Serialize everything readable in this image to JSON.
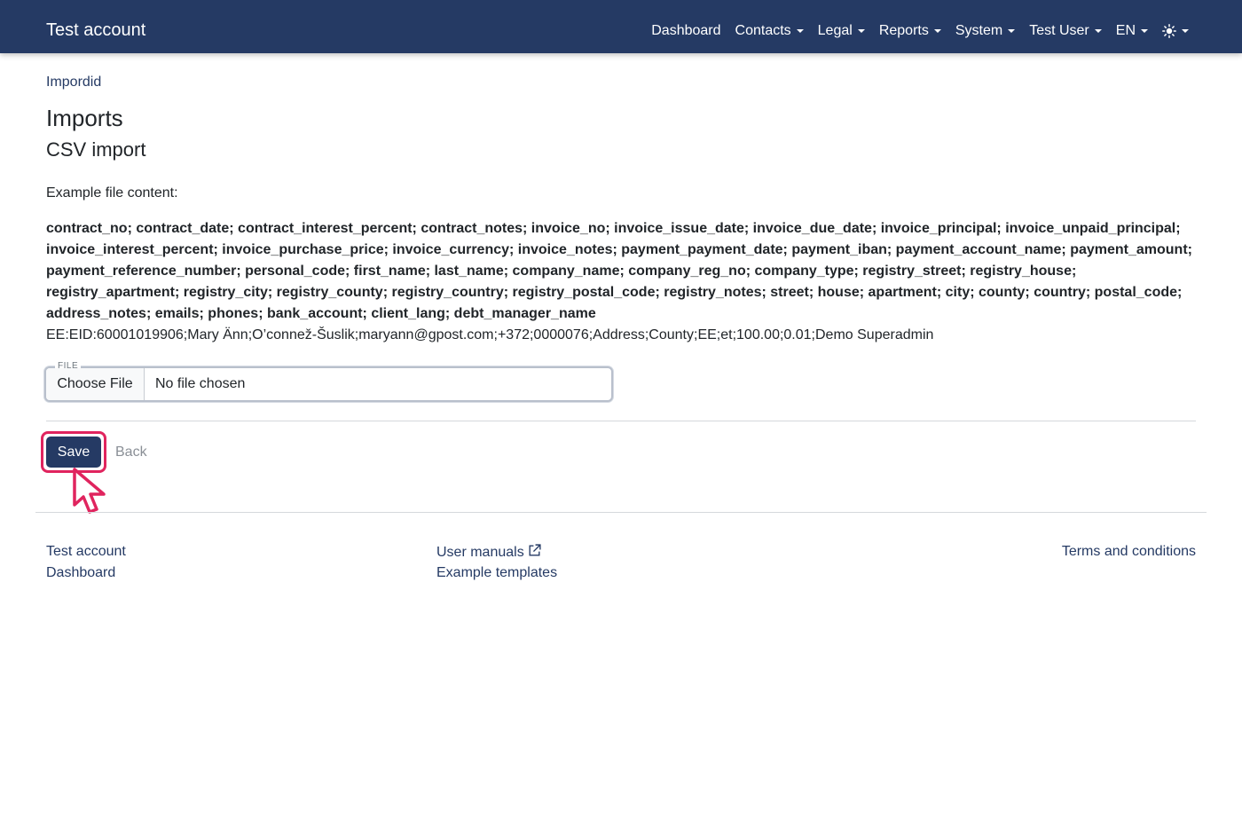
{
  "navbar": {
    "brand": "Test account",
    "items": [
      {
        "label": "Dashboard",
        "dropdown": false
      },
      {
        "label": "Contacts",
        "dropdown": true
      },
      {
        "label": "Legal",
        "dropdown": true
      },
      {
        "label": "Reports",
        "dropdown": true
      },
      {
        "label": "System",
        "dropdown": true
      },
      {
        "label": "Test User",
        "dropdown": true
      },
      {
        "label": "EN",
        "dropdown": true
      }
    ],
    "theme_icon": "sun-icon",
    "bg_color": "#253a64"
  },
  "breadcrumb": "Impordid",
  "page": {
    "title": "Imports",
    "subtitle": "CSV import",
    "example_label": "Example file content:",
    "example_headers": "contract_no; contract_date; contract_interest_percent; contract_notes; invoice_no; invoice_issue_date; invoice_due_date; invoice_principal; invoice_unpaid_principal; invoice_interest_percent; invoice_purchase_price; invoice_currency; invoice_notes; payment_payment_date; payment_iban; payment_account_name; payment_amount; payment_reference_number; personal_code; first_name; last_name; company_name; company_reg_no; company_type; registry_street; registry_house; registry_apartment; registry_city; registry_county; registry_country; registry_postal_code; registry_notes; street; house; apartment; city; county; country; postal_code; address_notes; emails; phones; bank_account; client_lang; debt_manager_name",
    "example_row": "EE:EID:60001019906;Mary Änn;O’connež-Šuslik;maryann@gpost.com;+372;0000076;Address;County;EE;et;100.00;0.01;Demo Superadmin"
  },
  "file_input": {
    "legend": "FILE",
    "button_label": "Choose File",
    "status": "No file chosen"
  },
  "actions": {
    "save_label": "Save",
    "back_label": "Back",
    "highlight_color": "#e0245e"
  },
  "footer": {
    "col1": [
      "Test account",
      "Dashboard"
    ],
    "col2": [
      "User manuals",
      "Example templates"
    ],
    "col3": [
      "Terms and conditions"
    ]
  }
}
